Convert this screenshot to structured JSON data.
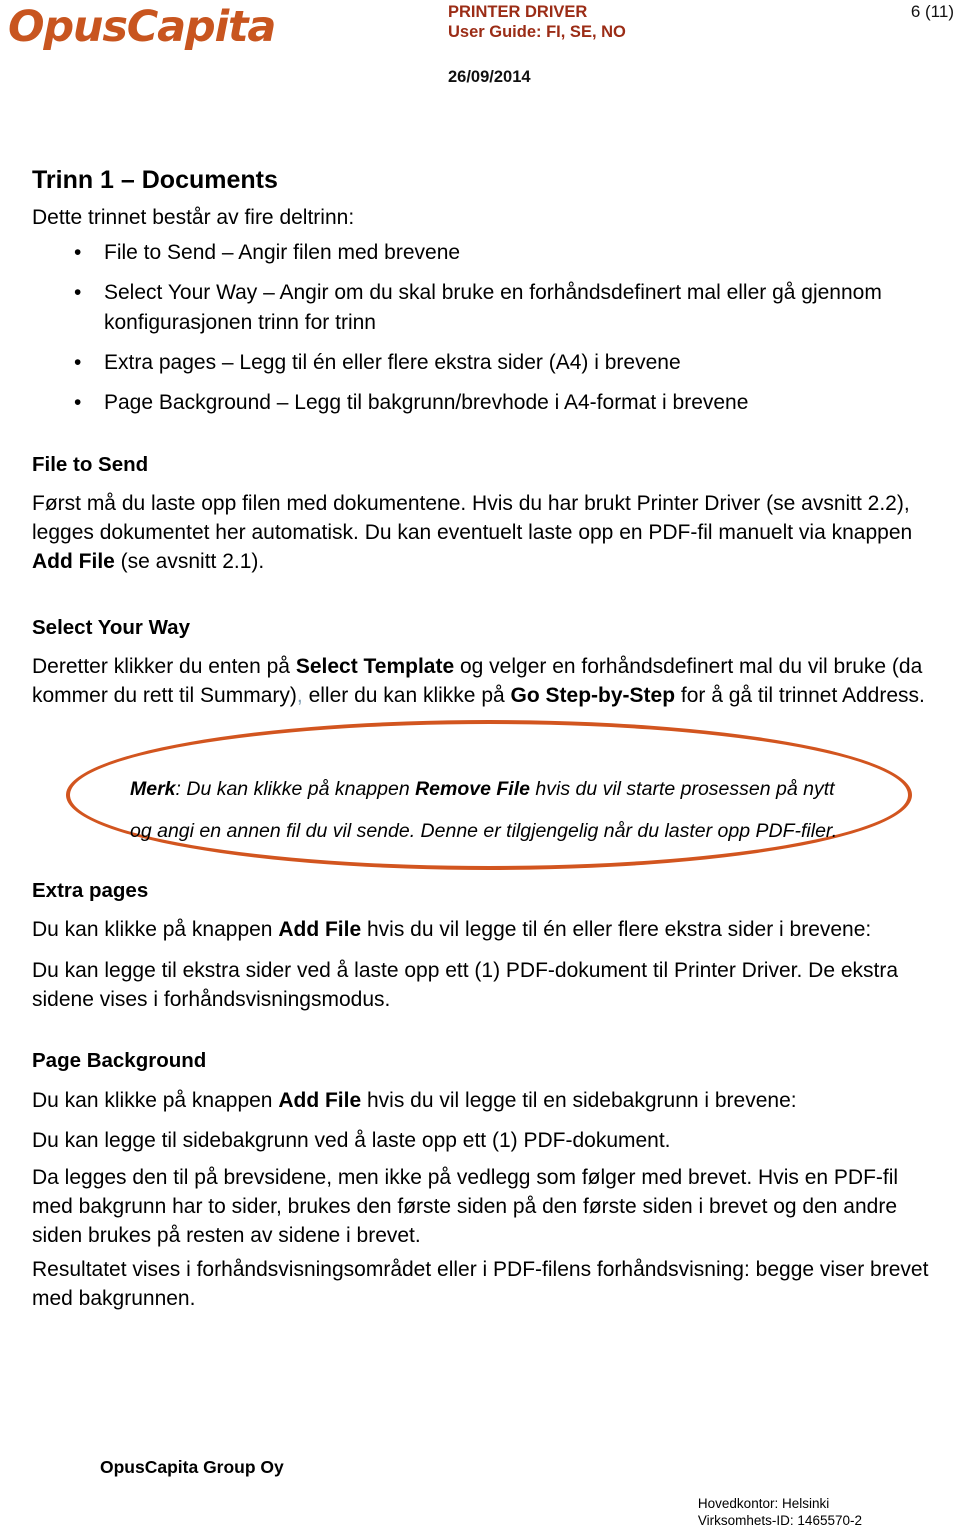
{
  "header": {
    "logo_text": "OpusCapita",
    "doc_title": "PRINTER DRIVER",
    "doc_subtitle": "User Guide: FI, SE, NO",
    "date": "26/09/2014",
    "page_number": "6 (11)"
  },
  "main": {
    "title": "Trinn 1 – Documents",
    "intro": "Dette trinnet består av fire deltrinn:",
    "bullets": [
      "File to Send – Angir filen med brevene",
      "Select Your Way – Angir om du skal bruke en forhåndsdefinert mal eller gå gjennom konfigurasjonen trinn for trinn",
      "Extra pages – Legg til én eller flere ekstra sider (A4) i brevene",
      "Page Background – Legg til bakgrunn/brevhode i A4-format i brevene"
    ],
    "sections": {
      "file_to_send": {
        "heading": "File to Send",
        "p1_a": "Først må du laste opp filen med dokumentene. Hvis du har brukt Printer Driver (se avsnitt 2.2), legges dokumentet her automatisk. Du kan eventuelt laste opp en PDF-fil manuelt via knappen ",
        "p1_b": "Add File",
        "p1_c": " (se avsnitt 2.1)."
      },
      "select_your_way": {
        "heading": "Select Your Way",
        "p1_a": "Deretter klikker du enten på ",
        "p1_b": "Select Template",
        "p1_c": " og velger en forhåndsdefinert mal du vil bruke (da kommer du rett til Summary)",
        "p1_comma": ",",
        "p1_d": " eller du kan klikke på ",
        "p1_e": "Go Step-by-Step",
        "p1_f": " for å gå til trinnet Address."
      },
      "note": {
        "label": "Merk",
        "line1_a": ": Du kan klikke på knappen ",
        "line1_b": "Remove File",
        "line1_c": " hvis du vil starte prosessen på nytt",
        "line2": "og angi en annen fil du vil sende. Denne er tilgjengelig når du laster opp PDF-filer."
      },
      "extra_pages": {
        "heading": "Extra pages",
        "p1_a": "Du kan klikke på knappen ",
        "p1_b": "Add File",
        "p1_c": " hvis du vil legge til én eller flere ekstra sider i brevene:",
        "p2": "Du kan legge til ekstra sider ved å laste opp ett (1) PDF-dokument til Printer Driver. De ekstra sidene vises i forhåndsvisningsmodus."
      },
      "page_background": {
        "heading": "Page Background",
        "p1_a": "Du kan klikke på knappen ",
        "p1_b": "Add File",
        "p1_c": " hvis du vil legge til en sidebakgrunn i brevene:",
        "p2": "Du kan legge til sidebakgrunn ved å laste opp ett (1) PDF-dokument.",
        "p3": "Da legges den til på brevsidene, men ikke på vedlegg som følger med brevet. Hvis en PDF-fil med bakgrunn har to sider, brukes den første siden på den første siden i brevet og den andre siden brukes på resten av sidene i brevet.",
        "p4": "Resultatet vises i forhåndsvisningsområdet eller i PDF-filens forhåndsvisning: begge viser brevet med bakgrunnen."
      }
    }
  },
  "footer": {
    "company": "OpusCapita Group Oy",
    "hq": "Hovedkontor: Helsinki",
    "business_id": "Virksomhets-ID: 1465570-2"
  },
  "colors": {
    "brand_orange": "#C8551F",
    "highlight_ellipse": "#D2551F",
    "header_title": "#9B2C16"
  },
  "bullet_glyph": "•"
}
